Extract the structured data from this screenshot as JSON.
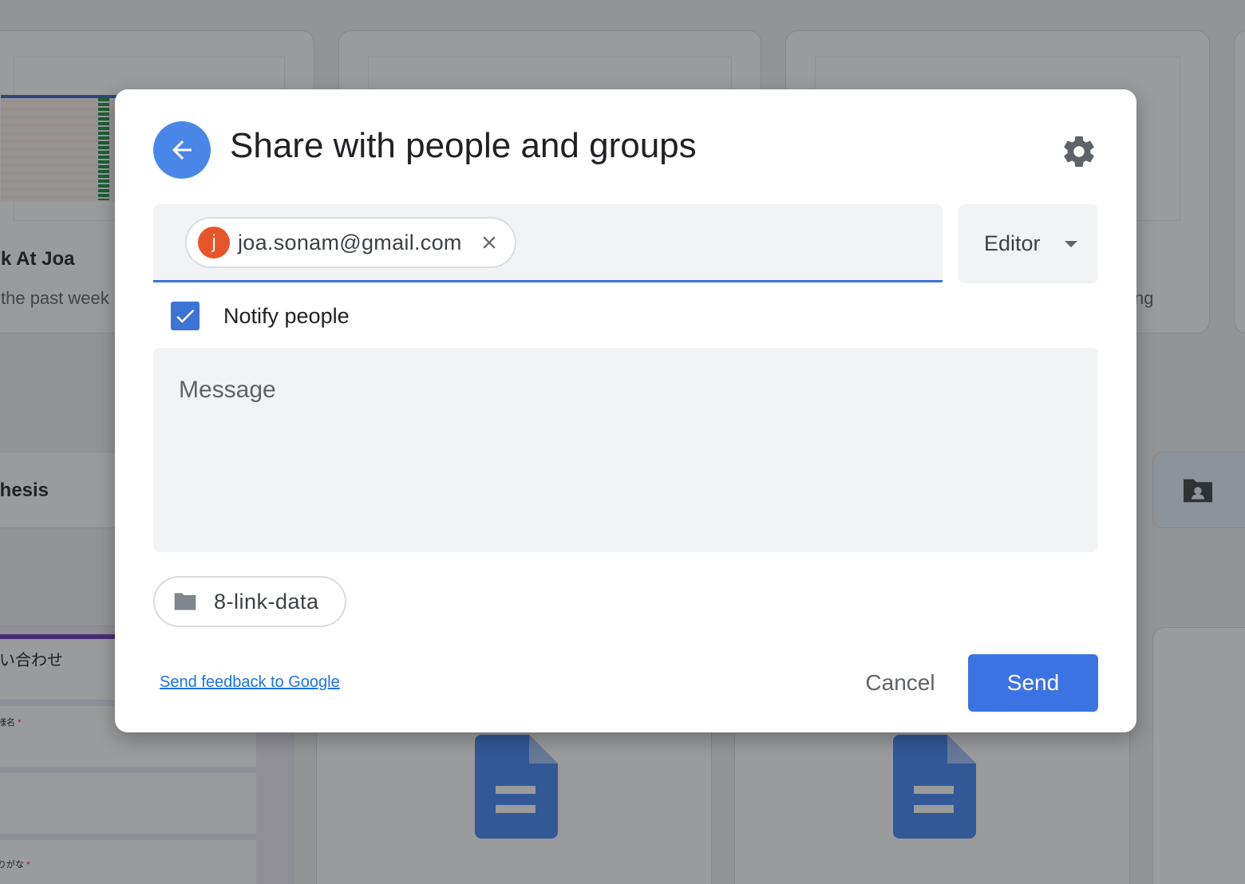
{
  "background": {
    "cards": [
      {
        "title": "k At Joa",
        "subtitle": "the past week"
      },
      {
        "title": "",
        "subtitle": ""
      },
      {
        "title": "",
        "subtitle": "ng"
      },
      {
        "title": "Thesis",
        "subtitle": ""
      },
      {
        "title": "い合わせ",
        "subtitle": ""
      }
    ],
    "form_field_1": "様名",
    "form_field_2": "りがな",
    "required_mark": "*"
  },
  "dialog": {
    "title": "Share with people and groups",
    "recipient": {
      "avatar_initial": "j",
      "email": "joa.sonam@gmail.com"
    },
    "role": {
      "selected": "Editor"
    },
    "notify": {
      "label": "Notify people",
      "checked": true
    },
    "message": {
      "placeholder": "Message"
    },
    "folder": {
      "name": "8-link-data"
    },
    "feedback_link": "Send feedback to Google",
    "cancel_label": "Cancel",
    "send_label": "Send"
  },
  "colors": {
    "accent": "#3b73e3",
    "back_button": "#4a86e8",
    "avatar": "#e8542a",
    "doc_icon": "#4285f4"
  },
  "icons": {
    "back": "arrow-left-icon",
    "settings": "gear-icon",
    "remove": "close-icon",
    "dropdown": "caret-down-icon",
    "check": "checkmark-icon",
    "folder": "folder-icon"
  }
}
